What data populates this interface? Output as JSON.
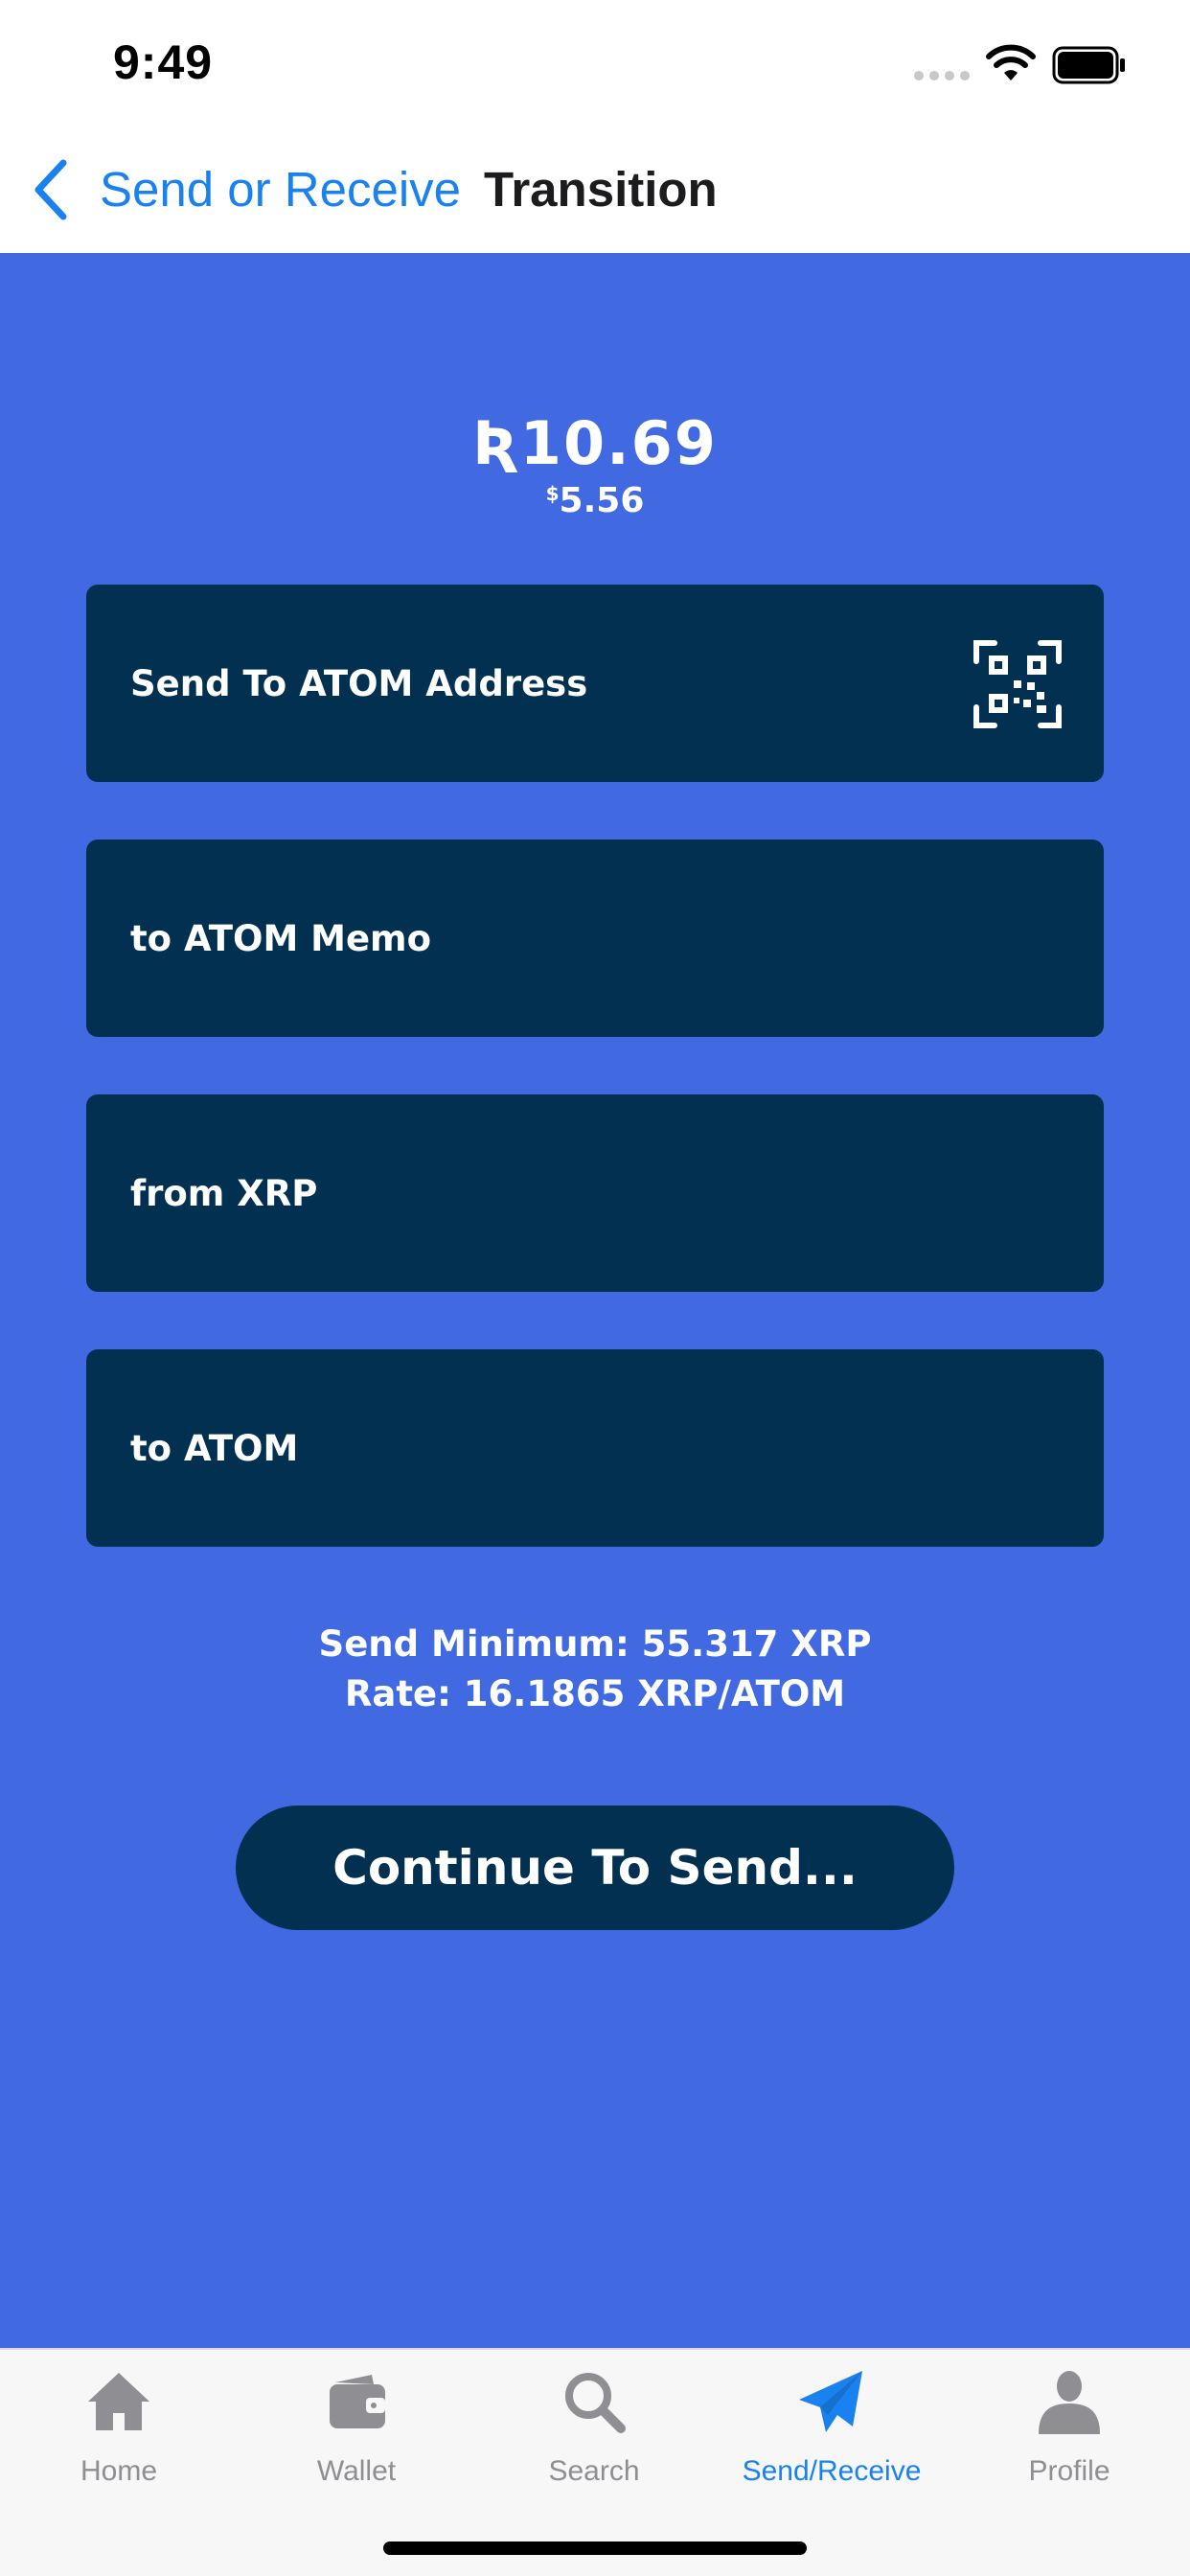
{
  "status_bar": {
    "time": "9:49",
    "icons": [
      "signal-icon",
      "wifi-icon",
      "battery-icon"
    ]
  },
  "nav": {
    "back_label": "Send or Receive",
    "title": "Transition"
  },
  "main": {
    "background_color": "#4169e1",
    "field_color": "#023050",
    "amount_primary": "Ʀ10.69",
    "amount_secondary_symbol": "$",
    "amount_secondary_value": "5.56",
    "fields": [
      {
        "label": "Send To ATOM Address",
        "icon": "qr-code-icon"
      },
      {
        "label": "to ATOM Memo"
      },
      {
        "label": "from XRP"
      },
      {
        "label": "to ATOM"
      }
    ],
    "send_minimum": "Send Minimum: 55.317 XRP",
    "rate": "Rate: 16.1865 XRP/ATOM",
    "continue_label": "Continue To Send..."
  },
  "tab_bar": {
    "active_color": "#1a82f0",
    "inactive_color": "#8e8e93",
    "tabs": [
      {
        "label": "Home",
        "icon": "home-icon",
        "active": false
      },
      {
        "label": "Wallet",
        "icon": "wallet-icon",
        "active": false
      },
      {
        "label": "Search",
        "icon": "search-icon",
        "active": false
      },
      {
        "label": "Send/Receive",
        "icon": "paper-plane-icon",
        "active": true
      },
      {
        "label": "Profile",
        "icon": "person-icon",
        "active": false
      }
    ]
  }
}
